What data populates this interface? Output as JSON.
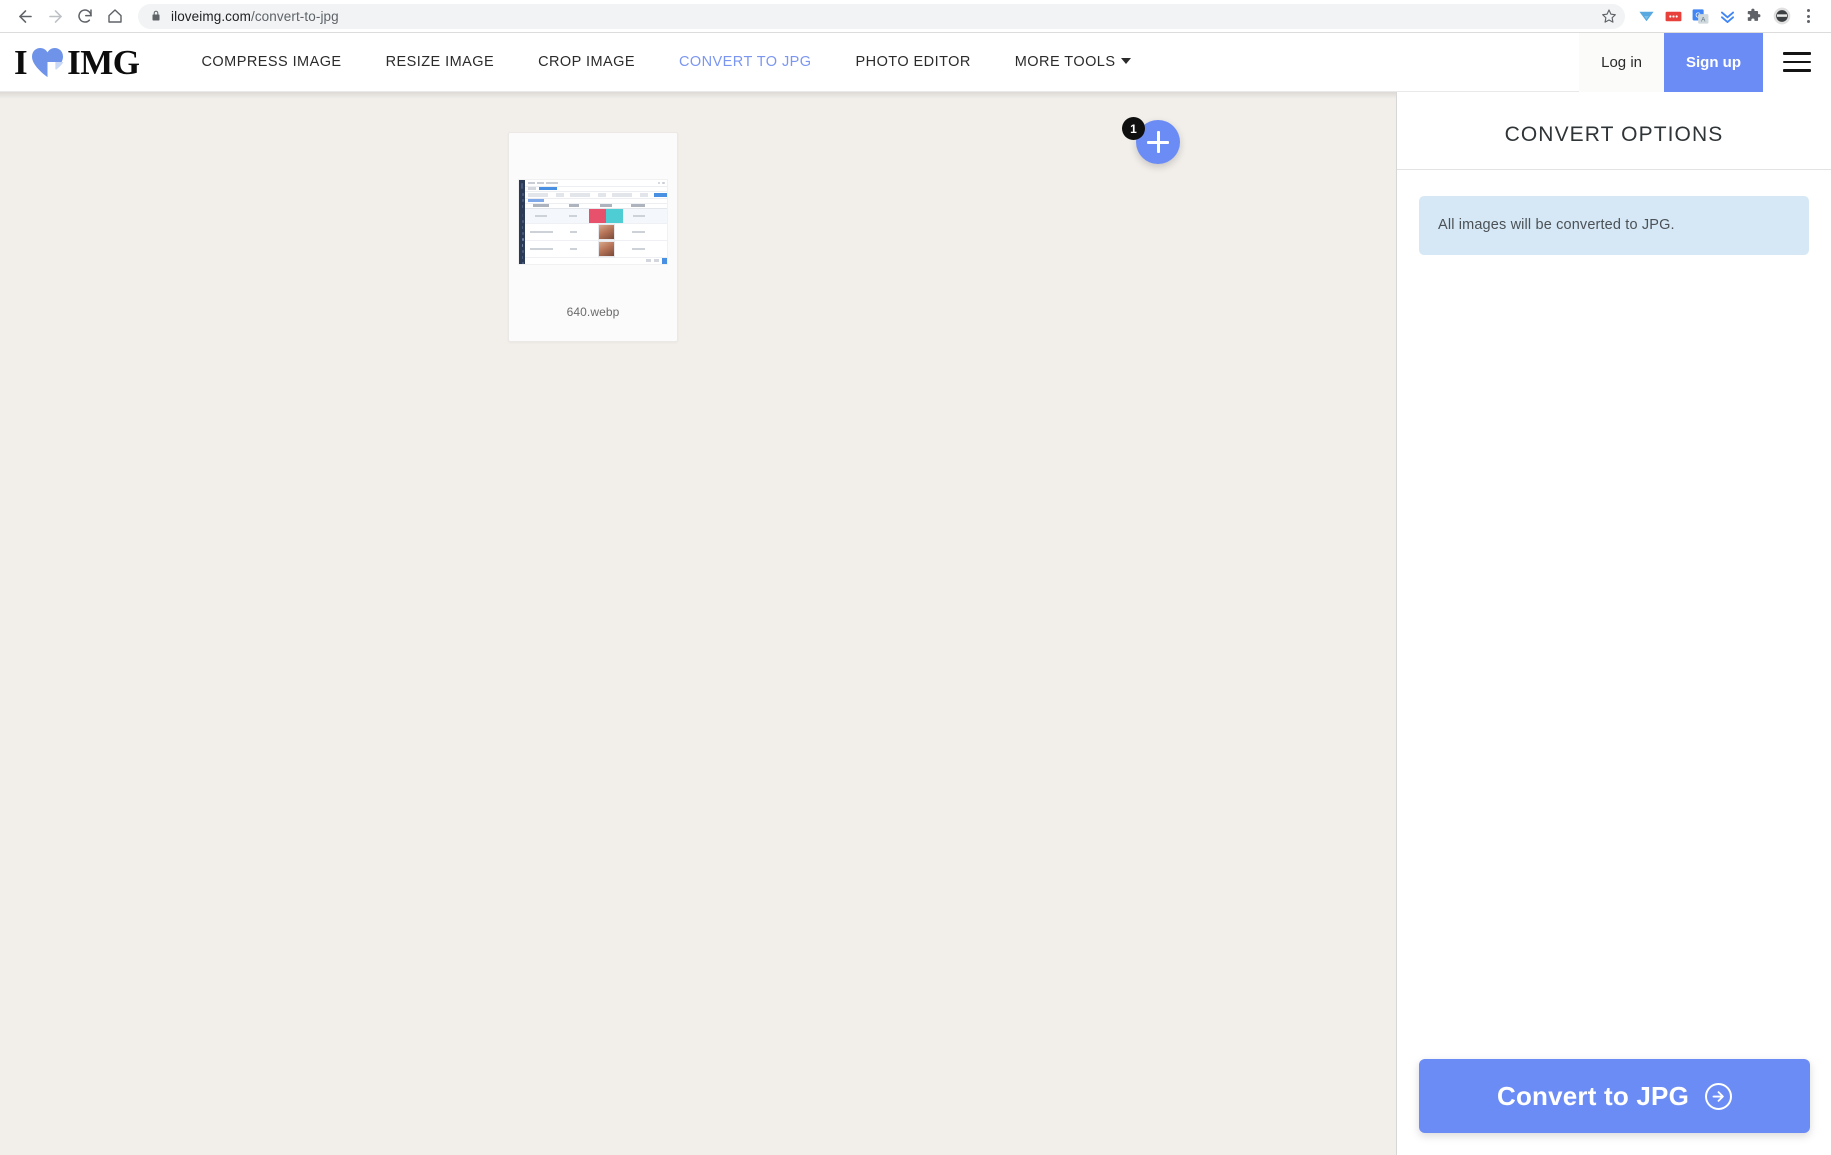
{
  "browser": {
    "back_icon": "back-arrow-icon",
    "forward_icon": "forward-arrow-icon",
    "reload_icon": "reload-icon",
    "home_icon": "home-icon",
    "lock_icon": "lock-icon",
    "url_host": "iloveimg.com",
    "url_path": "/convert-to-jpg",
    "url_full": "iloveimg.com/convert-to-jpg",
    "star_icon": "bookmark-star-icon",
    "extensions": [
      {
        "name": "vimeo-extension-icon",
        "glyph": "V",
        "color": "#5aa8e0"
      },
      {
        "name": "red-dots-extension-icon",
        "glyph": "•••",
        "color": "#e8413c"
      },
      {
        "name": "google-translate-extension-icon",
        "glyph": "G",
        "color": "#4285f4"
      },
      {
        "name": "double-chevron-extension-icon",
        "glyph": "»",
        "color": "#4285f4"
      },
      {
        "name": "puzzle-extensions-icon",
        "glyph": "⬟",
        "color": "#5f6368"
      },
      {
        "name": "profile-avatar-icon",
        "glyph": "●",
        "color": "#3c4043"
      }
    ],
    "menu_icon": "three-dot-menu-icon"
  },
  "site_header": {
    "logo": {
      "prefix": "I",
      "heart_icon": "heart-icon",
      "suffix": "IMG",
      "heart_color": "#6e93e8"
    },
    "nav_items": [
      {
        "label": "COMPRESS IMAGE",
        "active": false
      },
      {
        "label": "RESIZE IMAGE",
        "active": false
      },
      {
        "label": "CROP IMAGE",
        "active": false
      },
      {
        "label": "CONVERT TO JPG",
        "active": true
      },
      {
        "label": "PHOTO EDITOR",
        "active": false
      },
      {
        "label": "MORE TOOLS",
        "active": false,
        "has_caret": true
      }
    ],
    "login_label": "Log in",
    "signup_label": "Sign up",
    "menu_icon": "hamburger-menu-icon",
    "accent_color": "#6c8cf5",
    "active_nav_color": "#7b96f0"
  },
  "workspace": {
    "background_color": "#f2efeb",
    "file_card": {
      "filename": "640.webp",
      "thumbnail_icon": "dashboard-screenshot-thumbnail"
    },
    "add_more_button": {
      "icon": "plus-icon",
      "badge_count": "1",
      "color": "#6c8cf5",
      "badge_color": "#0f0f0f"
    }
  },
  "side_panel": {
    "title": "CONVERT OPTIONS",
    "info_message": "All images will be converted to JPG.",
    "info_background": "#d6e8f5",
    "action_button": {
      "label": "Convert to JPG",
      "icon": "arrow-right-circle-icon",
      "color": "#6c8cf5"
    }
  }
}
